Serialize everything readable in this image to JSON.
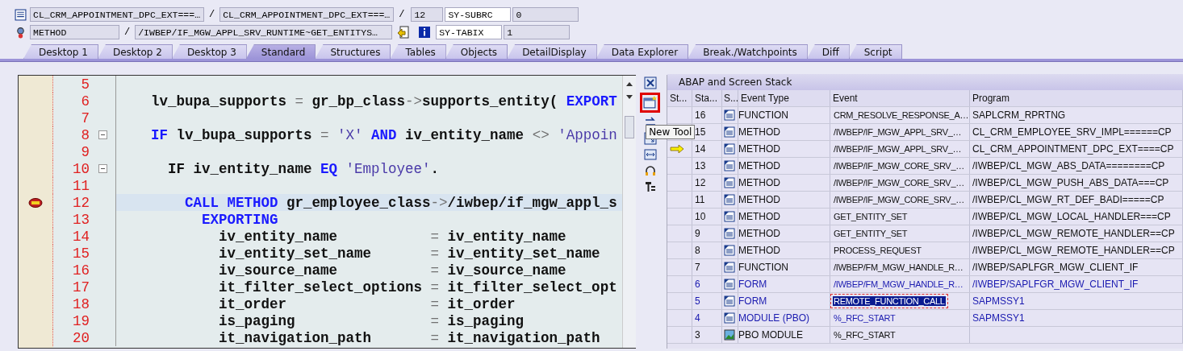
{
  "header": {
    "row1": {
      "include": "CL_CRM_APPOINTMENT_DPC_EXT===…",
      "program": "CL_CRM_APPOINTMENT_DPC_EXT===…",
      "line": "12",
      "sysvar": "SY-SUBRC",
      "sysval": "0"
    },
    "row2": {
      "type": "METHOD",
      "name": "/IWBEP/IF_MGW_APPL_SRV_RUNTIME~GET_ENTITYS…",
      "sysvar": "SY-TABIX",
      "sysval": "1"
    },
    "separators": [
      "/",
      "/",
      "/"
    ]
  },
  "tabs": [
    {
      "label": "Desktop 1",
      "selected": false
    },
    {
      "label": "Desktop 2",
      "selected": false
    },
    {
      "label": "Desktop 3",
      "selected": false
    },
    {
      "label": "Standard",
      "selected": true
    },
    {
      "label": "Structures",
      "selected": false
    },
    {
      "label": "Tables",
      "selected": false
    },
    {
      "label": "Objects",
      "selected": false
    },
    {
      "label": "DetailDisplay",
      "selected": false
    },
    {
      "label": "Data Explorer",
      "selected": false
    },
    {
      "label": "Break./Watchpoints",
      "selected": false
    },
    {
      "label": "Diff",
      "selected": false
    },
    {
      "label": "Script",
      "selected": false
    }
  ],
  "code": [
    {
      "number": "5",
      "fold": false,
      "breakpoint": false,
      "current": false
    },
    {
      "number": "6",
      "fold": false,
      "breakpoint": false,
      "current": false,
      "segments": [
        {
          "kind": "id",
          "text": "    lv_bupa_supports "
        },
        {
          "kind": "op",
          "text": "="
        },
        {
          "kind": "id",
          "text": " gr_bp_class"
        },
        {
          "kind": "op",
          "text": "->"
        },
        {
          "kind": "id",
          "text": "supports_entity( "
        },
        {
          "kind": "kw",
          "text": "EXPORT"
        }
      ]
    },
    {
      "number": "7",
      "fold": false,
      "breakpoint": false,
      "current": false
    },
    {
      "number": "8",
      "fold": true,
      "breakpoint": false,
      "current": false,
      "segments": [
        {
          "kind": "kw",
          "text": "    IF"
        },
        {
          "kind": "id",
          "text": " lv_bupa_supports "
        },
        {
          "kind": "op",
          "text": "="
        },
        {
          "kind": "str",
          "text": " 'X' "
        },
        {
          "kind": "kw",
          "text": "AND"
        },
        {
          "kind": "id",
          "text": " iv_entity_name "
        },
        {
          "kind": "op",
          "text": "<>"
        },
        {
          "kind": "str",
          "text": " 'Appoin"
        }
      ]
    },
    {
      "number": "9",
      "fold": false,
      "breakpoint": false,
      "current": false
    },
    {
      "number": "10",
      "fold": true,
      "breakpoint": false,
      "current": false,
      "segments": [
        {
          "kind": "id",
          "text": "      IF iv_entity_name "
        },
        {
          "kind": "kw",
          "text": "EQ"
        },
        {
          "kind": "str",
          "text": " 'Employee'"
        },
        {
          "kind": "id",
          "text": "."
        }
      ]
    },
    {
      "number": "11",
      "fold": false,
      "breakpoint": false,
      "current": false
    },
    {
      "number": "12",
      "fold": false,
      "breakpoint": true,
      "current": true,
      "segments": [
        {
          "kind": "kw",
          "text": "        CALL METHOD"
        },
        {
          "kind": "id",
          "text": " gr_employee_class"
        },
        {
          "kind": "op",
          "text": "->"
        },
        {
          "kind": "id",
          "text": "/iwbep/if_mgw_appl_s"
        }
      ]
    },
    {
      "number": "13",
      "fold": false,
      "breakpoint": false,
      "current": false,
      "segments": [
        {
          "kind": "kw",
          "text": "          EXPORTING"
        }
      ]
    },
    {
      "number": "14",
      "fold": false,
      "breakpoint": false,
      "current": false,
      "segments": [
        {
          "kind": "id",
          "text": "            iv_entity_name           "
        },
        {
          "kind": "op",
          "text": "="
        },
        {
          "kind": "id",
          "text": " iv_entity_name"
        }
      ]
    },
    {
      "number": "15",
      "fold": false,
      "breakpoint": false,
      "current": false,
      "segments": [
        {
          "kind": "id",
          "text": "            iv_entity_set_name       "
        },
        {
          "kind": "op",
          "text": "="
        },
        {
          "kind": "id",
          "text": " iv_entity_set_name"
        }
      ]
    },
    {
      "number": "16",
      "fold": false,
      "breakpoint": false,
      "current": false,
      "segments": [
        {
          "kind": "id",
          "text": "            iv_source_name           "
        },
        {
          "kind": "op",
          "text": "="
        },
        {
          "kind": "id",
          "text": " iv_source_name"
        }
      ]
    },
    {
      "number": "17",
      "fold": false,
      "breakpoint": false,
      "current": false,
      "segments": [
        {
          "kind": "id",
          "text": "            it_filter_select_options "
        },
        {
          "kind": "op",
          "text": "="
        },
        {
          "kind": "id",
          "text": " it_filter_select_opt"
        }
      ]
    },
    {
      "number": "18",
      "fold": false,
      "breakpoint": false,
      "current": false,
      "segments": [
        {
          "kind": "id",
          "text": "            it_order                 "
        },
        {
          "kind": "op",
          "text": "="
        },
        {
          "kind": "id",
          "text": " it_order"
        }
      ]
    },
    {
      "number": "19",
      "fold": false,
      "breakpoint": false,
      "current": false,
      "segments": [
        {
          "kind": "id",
          "text": "            is_paging                "
        },
        {
          "kind": "op",
          "text": "="
        },
        {
          "kind": "id",
          "text": " is_paging"
        }
      ]
    },
    {
      "number": "20",
      "fold": false,
      "breakpoint": false,
      "current": false,
      "segments": [
        {
          "kind": "id",
          "text": "            it_navigation_path       "
        },
        {
          "kind": "op",
          "text": "="
        },
        {
          "kind": "id",
          "text": " it_navigation_path"
        }
      ]
    }
  ],
  "tooltip": "New Tool",
  "stack": {
    "title": "ABAP and Screen Stack",
    "columns": [
      "St...",
      "Sta...",
      "S...",
      "Event Type",
      "Event",
      "Program"
    ],
    "rows": [
      {
        "current": false,
        "level": "16",
        "kind": "source",
        "event_type": "FUNCTION",
        "event": "CRM_RESOLVE_RESPONSE_A…",
        "program": "SAPLCRM_RPRTNG",
        "highlighted": false,
        "selected": false
      },
      {
        "current": false,
        "level": "15",
        "kind": "source",
        "event_type": "METHOD",
        "event": "/IWBEP/IF_MGW_APPL_SRV_…",
        "program": "CL_CRM_EMPLOYEE_SRV_IMPL======CP",
        "highlighted": false,
        "selected": false
      },
      {
        "current": true,
        "level": "14",
        "kind": "source",
        "event_type": "METHOD",
        "event": "/IWBEP/IF_MGW_APPL_SRV_…",
        "program": "CL_CRM_APPOINTMENT_DPC_EXT====CP",
        "highlighted": false,
        "selected": false
      },
      {
        "current": false,
        "level": "13",
        "kind": "source",
        "event_type": "METHOD",
        "event": "/IWBEP/IF_MGW_CORE_SRV_…",
        "program": "/IWBEP/CL_MGW_ABS_DATA========CP",
        "highlighted": false,
        "selected": false
      },
      {
        "current": false,
        "level": "12",
        "kind": "source",
        "event_type": "METHOD",
        "event": "/IWBEP/IF_MGW_CORE_SRV_…",
        "program": "/IWBEP/CL_MGW_PUSH_ABS_DATA===CP",
        "highlighted": false,
        "selected": false
      },
      {
        "current": false,
        "level": "11",
        "kind": "source",
        "event_type": "METHOD",
        "event": "/IWBEP/IF_MGW_CORE_SRV_…",
        "program": "/IWBEP/CL_MGW_RT_DEF_BADI=====CP",
        "highlighted": false,
        "selected": false
      },
      {
        "current": false,
        "level": "10",
        "kind": "source",
        "event_type": "METHOD",
        "event": "GET_ENTITY_SET",
        "program": "/IWBEP/CL_MGW_LOCAL_HANDLER===CP",
        "highlighted": false,
        "selected": false
      },
      {
        "current": false,
        "level": "9",
        "kind": "source",
        "event_type": "METHOD",
        "event": "GET_ENTITY_SET",
        "program": "/IWBEP/CL_MGW_REMOTE_HANDLER==CP",
        "highlighted": false,
        "selected": false
      },
      {
        "current": false,
        "level": "8",
        "kind": "source",
        "event_type": "METHOD",
        "event": "PROCESS_REQUEST",
        "program": "/IWBEP/CL_MGW_REMOTE_HANDLER==CP",
        "highlighted": false,
        "selected": false
      },
      {
        "current": false,
        "level": "7",
        "kind": "source",
        "event_type": "FUNCTION",
        "event": "/IWBEP/FM_MGW_HANDLE_R…",
        "program": "/IWBEP/SAPLFGR_MGW_CLIENT_IF",
        "highlighted": false,
        "selected": false
      },
      {
        "current": false,
        "level": "6",
        "kind": "source",
        "event_type": "FORM",
        "event": "/IWBEP/FM_MGW_HANDLE_R…",
        "program": "/IWBEP/SAPLFGR_MGW_CLIENT_IF",
        "highlighted": true,
        "selected": false
      },
      {
        "current": false,
        "level": "5",
        "kind": "source",
        "event_type": "FORM",
        "event": "REMOTE_FUNCTION_CALL",
        "program": "SAPMSSY1",
        "highlighted": true,
        "selected": true
      },
      {
        "current": false,
        "level": "4",
        "kind": "source",
        "event_type": "MODULE (PBO)",
        "event": "%_RFC_START",
        "program": "SAPMSSY1",
        "highlighted": true,
        "selected": false
      },
      {
        "current": false,
        "level": "3",
        "kind": "screen",
        "event_type": "PBO MODULE",
        "event": "%_RFC_START",
        "highlighted": false,
        "selected": false
      }
    ]
  }
}
